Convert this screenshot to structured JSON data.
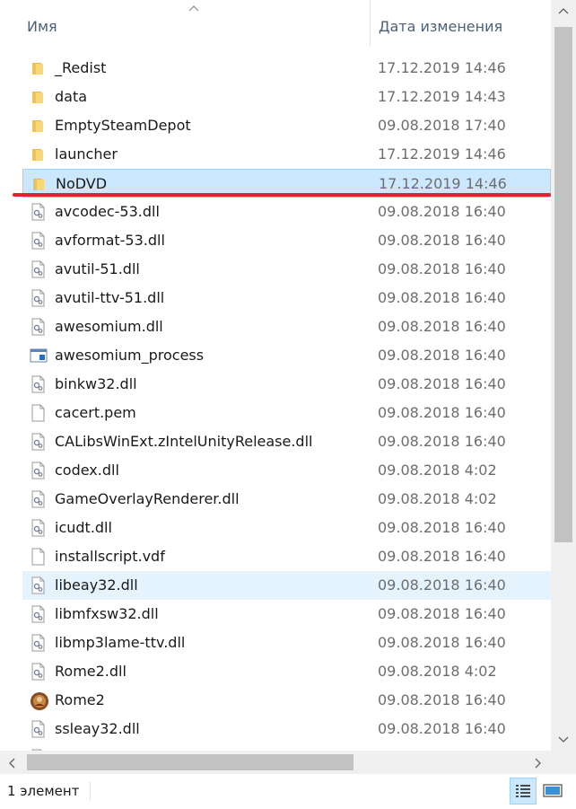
{
  "header": {
    "name_label": "Имя",
    "date_label": "Дата изменения",
    "sort_direction": "ascending"
  },
  "files": [
    {
      "name": "_Redist",
      "date": "17.12.2019 14:46",
      "icon": "folder-icon",
      "state": "normal"
    },
    {
      "name": "data",
      "date": "17.12.2019 14:43",
      "icon": "folder-icon",
      "state": "normal"
    },
    {
      "name": "EmptySteamDepot",
      "date": "09.08.2018 17:40",
      "icon": "folder-icon",
      "state": "normal"
    },
    {
      "name": "launcher",
      "date": "17.12.2019 14:46",
      "icon": "folder-icon",
      "state": "normal"
    },
    {
      "name": "NoDVD",
      "date": "17.12.2019 14:46",
      "icon": "folder-icon",
      "state": "selected"
    },
    {
      "name": "avcodec-53.dll",
      "date": "09.08.2018 16:40",
      "icon": "dll-icon",
      "state": "normal"
    },
    {
      "name": "avformat-53.dll",
      "date": "09.08.2018 16:40",
      "icon": "dll-icon",
      "state": "normal"
    },
    {
      "name": "avutil-51.dll",
      "date": "09.08.2018 16:40",
      "icon": "dll-icon",
      "state": "normal"
    },
    {
      "name": "avutil-ttv-51.dll",
      "date": "09.08.2018 16:40",
      "icon": "dll-icon",
      "state": "normal"
    },
    {
      "name": "awesomium.dll",
      "date": "09.08.2018 16:40",
      "icon": "dll-icon",
      "state": "normal"
    },
    {
      "name": "awesomium_process",
      "date": "09.08.2018 16:40",
      "icon": "exe-icon",
      "state": "normal"
    },
    {
      "name": "binkw32.dll",
      "date": "09.08.2018 16:40",
      "icon": "dll-icon",
      "state": "normal"
    },
    {
      "name": "cacert.pem",
      "date": "09.08.2018 16:40",
      "icon": "file-icon",
      "state": "normal"
    },
    {
      "name": "CALibsWinExt.zIntelUnityRelease.dll",
      "date": "09.08.2018 16:40",
      "icon": "dll-icon",
      "state": "normal"
    },
    {
      "name": "codex.dll",
      "date": "09.08.2018 4:02",
      "icon": "dll-icon",
      "state": "normal"
    },
    {
      "name": "GameOverlayRenderer.dll",
      "date": "09.08.2018 4:02",
      "icon": "dll-icon",
      "state": "normal"
    },
    {
      "name": "icudt.dll",
      "date": "09.08.2018 16:40",
      "icon": "dll-icon",
      "state": "normal"
    },
    {
      "name": "installscript.vdf",
      "date": "09.08.2018 16:40",
      "icon": "file-icon",
      "state": "normal"
    },
    {
      "name": "libeay32.dll",
      "date": "09.08.2018 16:40",
      "icon": "dll-icon",
      "state": "hover"
    },
    {
      "name": "libmfxsw32.dll",
      "date": "09.08.2018 16:40",
      "icon": "dll-icon",
      "state": "normal"
    },
    {
      "name": "libmp3lame-ttv.dll",
      "date": "09.08.2018 16:40",
      "icon": "dll-icon",
      "state": "normal"
    },
    {
      "name": "Rome2.dll",
      "date": "09.08.2018 4:02",
      "icon": "dll-icon",
      "state": "normal"
    },
    {
      "name": "Rome2",
      "date": "09.08.2018 16:40",
      "icon": "app-icon",
      "state": "normal"
    },
    {
      "name": "ssleay32.dll",
      "date": "09.08.2018 16:40",
      "icon": "dll-icon",
      "state": "normal"
    },
    {
      "name": "",
      "date": "",
      "icon": "dll-icon",
      "state": "normal"
    }
  ],
  "status": {
    "text": "1 элемент"
  },
  "colors": {
    "selected_bg": "#cce8ff",
    "hover_bg": "#e5f3ff",
    "annotation_red": "#e3222b",
    "folder_yellow": "#f8d775"
  }
}
